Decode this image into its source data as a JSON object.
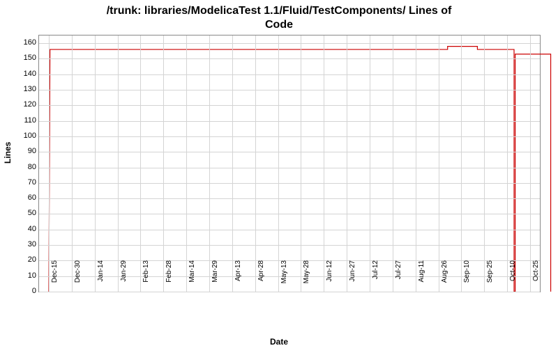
{
  "title_line1": "/trunk: libraries/ModelicaTest 1.1/Fluid/TestComponents/ Lines of",
  "title_line2": "Code",
  "x_axis_label": "Date",
  "y_axis_label": "Lines",
  "chart_data": {
    "type": "line",
    "title": "/trunk: libraries/ModelicaTest 1.1/Fluid/TestComponents/ Lines of Code",
    "xlabel": "Date",
    "ylabel": "Lines",
    "ylim": [
      0,
      165
    ],
    "y_ticks": [
      0,
      10,
      20,
      30,
      40,
      50,
      60,
      70,
      80,
      90,
      100,
      110,
      120,
      130,
      140,
      150,
      160
    ],
    "categories": [
      "15-Dec",
      "30-Dec",
      "14-Jan",
      "29-Jan",
      "13-Feb",
      "28-Feb",
      "14-Mar",
      "29-Mar",
      "13-Apr",
      "28-Apr",
      "13-May",
      "28-May",
      "12-Jun",
      "27-Jun",
      "12-Jul",
      "27-Jul",
      "11-Aug",
      "26-Aug",
      "10-Sep",
      "25-Sep",
      "10-Oct",
      "25-Oct"
    ],
    "series": [
      {
        "name": "Lines of Code",
        "color": "#cc0000",
        "points": [
          {
            "x_index": 0.0,
            "y": 0
          },
          {
            "x_index": 0.05,
            "y": 156
          },
          {
            "x_index": 17.4,
            "y": 156
          },
          {
            "x_index": 17.4,
            "y": 158
          },
          {
            "x_index": 18.7,
            "y": 158
          },
          {
            "x_index": 18.7,
            "y": 156
          },
          {
            "x_index": 20.3,
            "y": 156
          },
          {
            "x_index": 20.3,
            "y": 0
          },
          {
            "x_index": 20.35,
            "y": 0
          },
          {
            "x_index": 20.35,
            "y": 153
          },
          {
            "x_index": 21.9,
            "y": 153
          },
          {
            "x_index": 21.9,
            "y": 0
          }
        ]
      }
    ]
  }
}
